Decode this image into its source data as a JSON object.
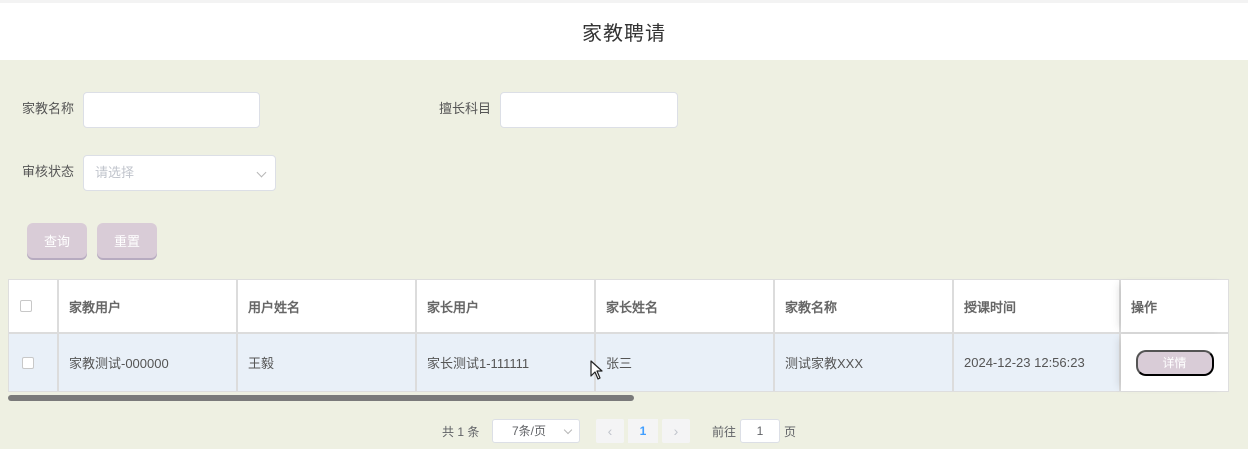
{
  "header": {
    "title": "家教聘请"
  },
  "search": {
    "tutor_name_label": "家教名称",
    "tutor_name_value": "",
    "subject_label": "擅长科目",
    "subject_value": "",
    "status_label": "审核状态",
    "status_placeholder": "请选择",
    "query_button": "查询",
    "reset_button": "重置"
  },
  "table": {
    "columns": [
      "家教用户",
      "用户姓名",
      "家长用户",
      "家长姓名",
      "家教名称",
      "授课时间",
      "操作"
    ],
    "rows": [
      {
        "tutor_user": "家教测试-000000",
        "user_name": "王毅",
        "parent_user": "家长测试1-111111",
        "parent_name": "张三",
        "tutor_name": "测试家教XXX",
        "time": "2024-12-23 12:56:23",
        "action": "详情"
      }
    ]
  },
  "pagination": {
    "total": "共 1 条",
    "page_size": "7条/页",
    "current_page": "1",
    "goto_label": "前往",
    "goto_value": "1",
    "page_suffix": "页",
    "prev_icon": "chevron-left-icon",
    "next_icon": "chevron-right-icon"
  },
  "colors": {
    "background": "#eef0e2",
    "button": "#d9ccd7",
    "row_highlight": "#e9f0f8",
    "active_page": "#409eff"
  }
}
